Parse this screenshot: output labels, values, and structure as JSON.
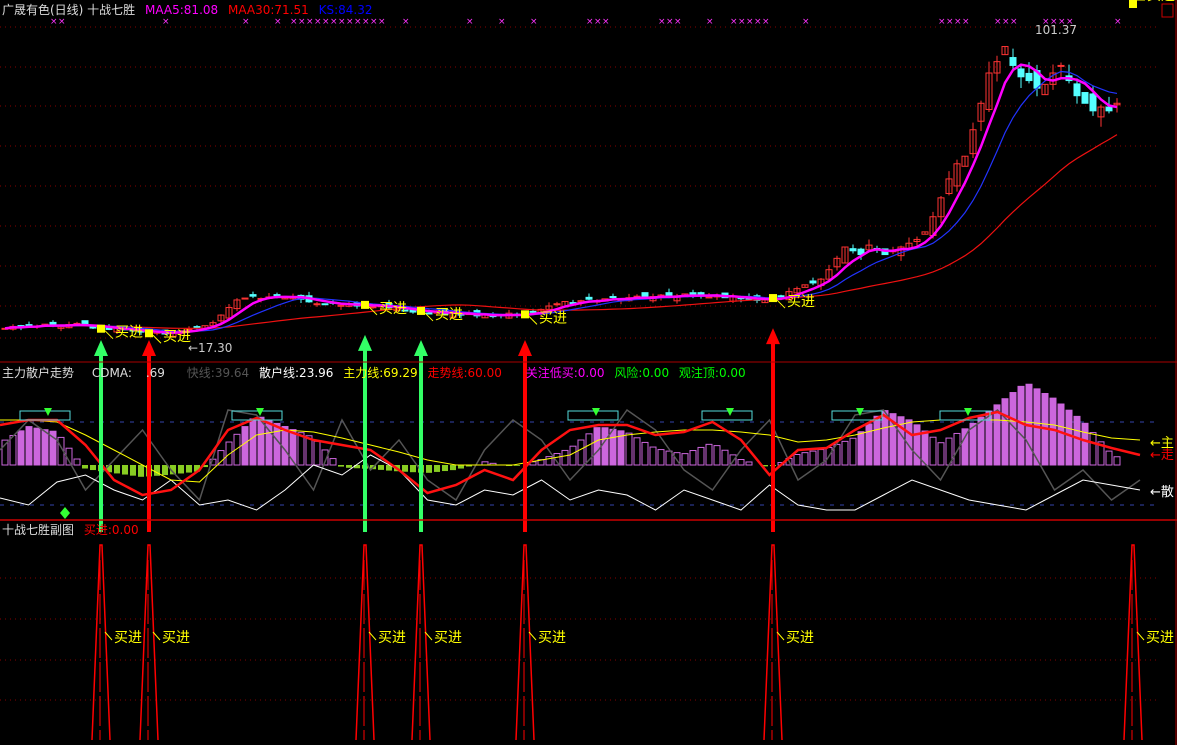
{
  "main_panel": {
    "title": "广晟有色(日线) 十战七胜",
    "indicators": [
      {
        "label": "MAA5:81.08",
        "color": "#ff00ff"
      },
      {
        "label": "MAA30:71.51",
        "color": "#ff0000"
      },
      {
        "label": "KS:84.32",
        "color": "#0000ff"
      }
    ],
    "high_label": "101.37",
    "low_label": "←17.30",
    "buy_label": "买进"
  },
  "mid_panel": {
    "title": "主力散户走势",
    "indicators": [
      {
        "label": "CDMA:",
        "color": "#dddddd"
      },
      {
        "label": ".69",
        "color": "#dddddd"
      },
      {
        "label": "快线:39.64",
        "color": "#555555"
      },
      {
        "label": "散户线:23.96",
        "color": "#ffffff"
      },
      {
        "label": "主力线:69.29",
        "color": "#ffff00"
      },
      {
        "label": "走势线:60.00",
        "color": "#ff0000"
      },
      {
        "label": "关注低买:0.00",
        "color": "#ff00ff"
      },
      {
        "label": "风险:0.00",
        "color": "#00ff00"
      },
      {
        "label": "观注顶:0.00",
        "color": "#00ff00"
      }
    ],
    "right_labels": [
      {
        "label": "←主",
        "color": "#ffff00"
      },
      {
        "label": "←走",
        "color": "#ff0000"
      },
      {
        "label": "←散",
        "color": "#ffffff"
      }
    ]
  },
  "sub_panel": {
    "title": "十战七胜副图",
    "indicator": "买进:0.00",
    "buy_label": "买进"
  },
  "chart_data": {
    "type": "candlestick",
    "title": "广晟有色(日线)",
    "ylim": [
      17.3,
      101.37
    ],
    "closes": [
      22.5,
      23,
      22.8,
      23.4,
      23.1,
      23.6,
      23.2,
      22.9,
      23.5,
      23.8,
      23.3,
      22.7,
      22.4,
      22.2,
      22.6,
      22.1,
      21.8,
      21.5,
      21.2,
      21.6,
      21,
      21.4,
      21.9,
      22.3,
      22.8,
      23.2,
      24,
      26,
      28,
      30,
      30.5,
      31,
      30.4,
      30.8,
      31.2,
      30.6,
      30.9,
      30.2,
      29.5,
      29,
      28.8,
      29.2,
      28.6,
      28.9,
      28.4,
      28.7,
      28.2,
      28.5,
      28,
      27.6,
      27.2,
      26.8,
      27.1,
      26.5,
      26.9,
      26.2,
      26.6,
      26,
      26.4,
      25.8,
      26.1,
      25.6,
      26,
      26.5,
      25.9,
      26.2,
      26.8,
      27.5,
      28.4,
      29,
      29.6,
      29.2,
      29.8,
      30.2,
      29.7,
      30.3,
      30.8,
      30.1,
      30.6,
      31,
      30.4,
      30.9,
      31.3,
      30.7,
      31.1,
      31.6,
      31,
      31.4,
      30.8,
      31.2,
      30.6,
      30.9,
      30.4,
      30.2,
      29.9,
      30,
      30.5,
      31,
      32.2,
      33,
      34,
      34.5,
      35.5,
      38,
      41,
      44,
      43,
      42,
      44.5,
      43.5,
      42,
      43,
      44,
      45,
      46,
      48,
      52,
      57,
      62,
      66,
      68,
      75,
      82,
      90,
      93,
      97,
      92,
      89,
      88,
      86,
      87,
      90,
      92,
      88,
      84,
      82,
      80,
      81,
      80,
      82
    ],
    "buy_signal_bars": [
      12,
      18,
      45,
      52,
      65,
      96,
      141
    ],
    "buy_signal_arrow_colors": [
      "#33ff66",
      "#ff0000",
      "#33ff66",
      "#33ff66",
      "#ff0000",
      "#ff0000",
      "#ff0000"
    ],
    "x_mark_bars": [
      6,
      7,
      20,
      30,
      34,
      36,
      37,
      38,
      39,
      40,
      41,
      42,
      43,
      44,
      45,
      46,
      47,
      50,
      58,
      62,
      66,
      73,
      74,
      75,
      82,
      83,
      84,
      88,
      91,
      92,
      93,
      94,
      95,
      100,
      117,
      118,
      119,
      120,
      124,
      125,
      126,
      130,
      131,
      132,
      133,
      139
    ],
    "mid_series": {
      "trend_red": [
        85,
        90,
        90,
        65,
        30,
        15,
        20,
        40,
        80,
        92,
        80,
        70,
        65,
        60,
        40,
        17,
        25,
        40,
        30,
        60,
        80,
        85,
        85,
        75,
        78,
        88,
        70,
        35,
        60,
        62,
        80,
        95,
        75,
        80,
        92,
        98,
        85,
        80,
        70,
        62,
        55
      ],
      "main_yellow": [
        90,
        90,
        88,
        75,
        60,
        45,
        30,
        28,
        55,
        75,
        80,
        78,
        72,
        65,
        58,
        50,
        45,
        45,
        45,
        50,
        55,
        70,
        75,
        78,
        80,
        80,
        78,
        75,
        68,
        70,
        75,
        82,
        88,
        90,
        90,
        90,
        88,
        85,
        78,
        72,
        70
      ],
      "retail_white": [
        12,
        5,
        28,
        35,
        20,
        10,
        30,
        5,
        10,
        0,
        20,
        45,
        35,
        55,
        40,
        10,
        5,
        20,
        15,
        30,
        10,
        20,
        15,
        0,
        20,
        10,
        0,
        25,
        5,
        0,
        0,
        15,
        30,
        20,
        10,
        5,
        0,
        15,
        30,
        25,
        20
      ],
      "fast_gray": [
        60,
        90,
        70,
        20,
        50,
        80,
        40,
        10,
        100,
        95,
        60,
        20,
        90,
        40,
        70,
        30,
        10,
        60,
        90,
        70,
        30,
        60,
        100,
        80,
        40,
        20,
        60,
        90,
        30,
        50,
        95,
        100,
        60,
        30,
        80,
        100,
        70,
        20,
        40,
        10,
        30
      ],
      "histogram": [
        20,
        35,
        30,
        -5,
        -10,
        -15,
        -12,
        -8,
        20,
        45,
        35,
        25,
        -3,
        -5,
        -8,
        -10,
        -6,
        3,
        -2,
        5,
        15,
        35,
        30,
        15,
        10,
        20,
        5,
        -3,
        10,
        15,
        25,
        50,
        40,
        20,
        35,
        55,
        75,
        60,
        40,
        10,
        -3
      ]
    }
  }
}
